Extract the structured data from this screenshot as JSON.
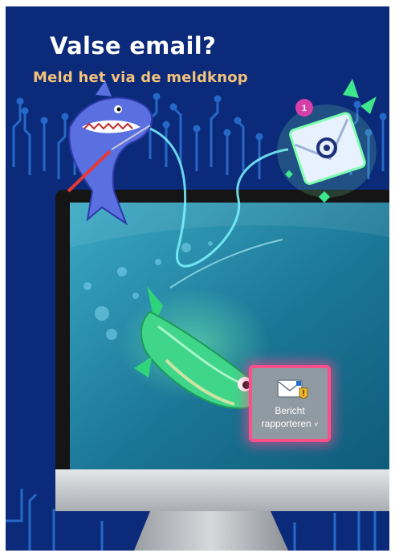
{
  "headline": "Valse email?",
  "subheadline": "Meld het via de meldknop",
  "report_button": {
    "line1": "Bericht",
    "line2": "rapporteren",
    "dropdown_glyph": "˅"
  },
  "notification_count": "1",
  "colors": {
    "background": "#0b2a7a",
    "circuit": "#1f63c4",
    "subheadline": "#f4c27a",
    "highlight": "#ff4f8b",
    "screen": "#1e7ea0",
    "monitor_frame": "#1a1a1a",
    "monitor_chin": "#c5c8cc"
  },
  "icons": [
    "shark-illustration",
    "fish-illustration",
    "email-envelope-icon",
    "envelope-warning-icon",
    "monitor-illustration"
  ]
}
